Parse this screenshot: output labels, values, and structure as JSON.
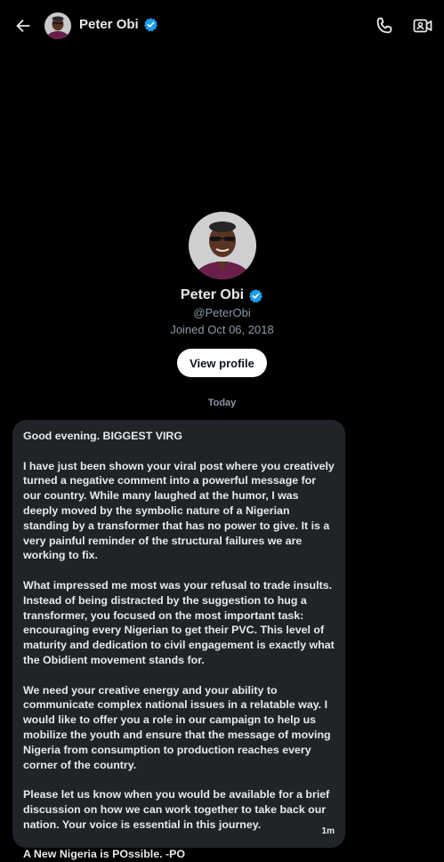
{
  "header": {
    "name": "Peter Obi",
    "back_icon": "arrow-left-icon",
    "call_icon": "phone-icon",
    "video_icon": "video-camera-icon"
  },
  "profile": {
    "name": "Peter Obi",
    "handle": "@PeterObi",
    "joined": "Joined Oct 06, 2018",
    "view_profile_label": "View profile"
  },
  "day_separator": "Today",
  "message": {
    "paragraphs": [
      "Good evening. BIGGEST VIRG",
      "I have just been shown your viral post where you creatively turned a negative comment into a powerful message for our country. While many laughed at the humor, I was deeply moved by the symbolic nature of a Nigerian standing by a transformer that has no power to give. It is a very painful reminder of the structural failures we are working to fix.",
      "What impressed me most was your refusal to trade insults. Instead of being distracted by the suggestion to hug a transformer, you focused on the most important task: encouraging every Nigerian to get their PVC. This level of maturity and dedication to civil engagement is exactly what the Obidient movement stands for.",
      "We need your creative energy and your ability to communicate complex national issues in a relatable way. I would like to offer you a role in our campaign to help us mobilize the youth and ensure that the message of moving Nigeria from consumption to production reaches every corner of the country.",
      "Please let us know when you would be available for a brief discussion on how we can work together to take back our nation. Your voice is essential in this journey.",
      "A New Nigeria is POssible. -PO"
    ],
    "time": "1m"
  },
  "colors": {
    "background": "#000000",
    "bubble": "#202327",
    "verified": "#1d9bf0",
    "muted_text": "#8b98a5"
  }
}
